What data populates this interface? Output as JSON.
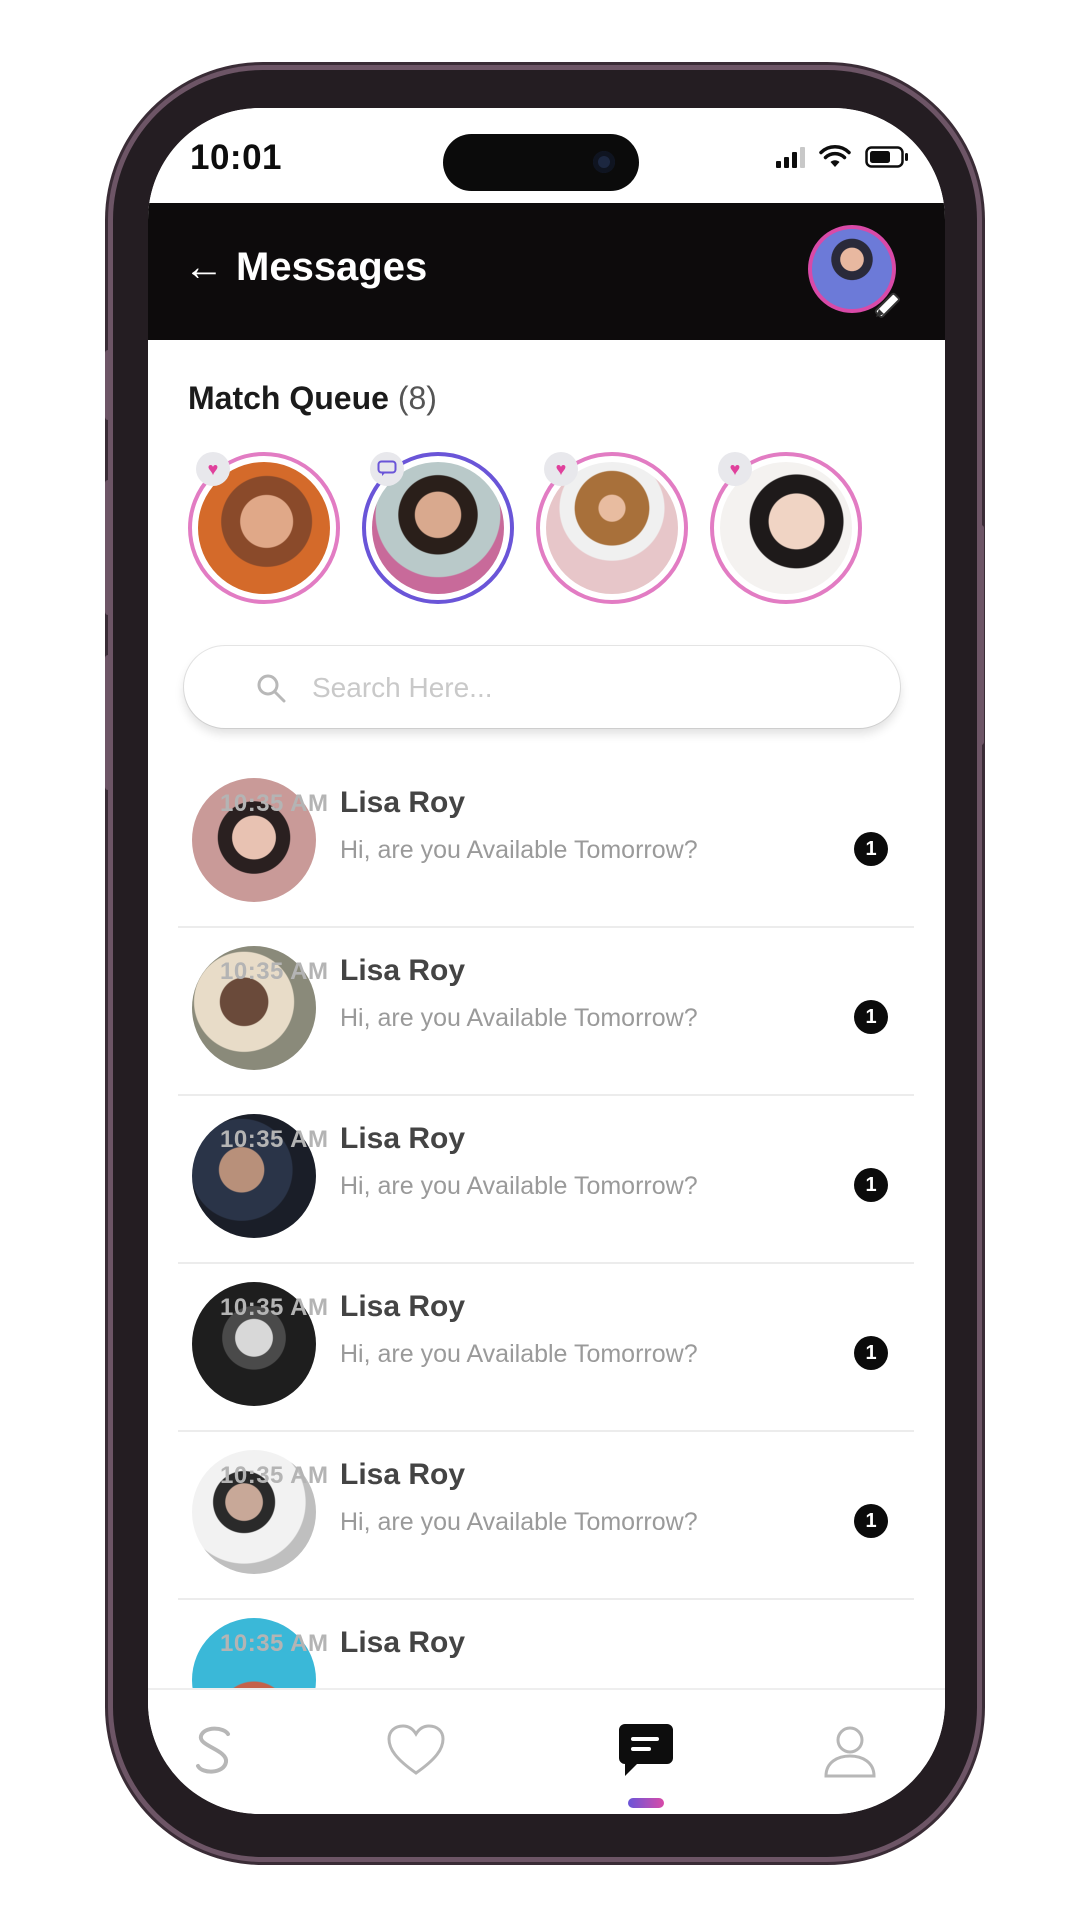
{
  "status_bar": {
    "time": "10:01"
  },
  "header": {
    "title": "Messages"
  },
  "match_queue": {
    "label": "Match Queue",
    "count": "(8)",
    "items": [
      {
        "badge": "heart-icon"
      },
      {
        "badge": "chat-icon"
      },
      {
        "badge": "heart-icon"
      },
      {
        "badge": "heart-icon"
      }
    ]
  },
  "search": {
    "placeholder": "Search Here..."
  },
  "conversations": [
    {
      "name": "Lisa Roy",
      "message": "Hi, are you Available Tomorrow?",
      "time": "10:35 AM",
      "unread": "1"
    },
    {
      "name": "Lisa Roy",
      "message": "Hi, are you Available Tomorrow?",
      "time": "10:35 AM",
      "unread": "1"
    },
    {
      "name": "Lisa Roy",
      "message": "Hi, are you Available Tomorrow?",
      "time": "10:35 AM",
      "unread": "1"
    },
    {
      "name": "Lisa Roy",
      "message": "Hi, are you Available Tomorrow?",
      "time": "10:35 AM",
      "unread": "1"
    },
    {
      "name": "Lisa Roy",
      "message": "Hi, are you Available Tomorrow?",
      "time": "10:35 AM",
      "unread": "1"
    },
    {
      "name": "Lisa Roy",
      "message": "",
      "time": "10:35 AM",
      "unread": ""
    }
  ],
  "bottom_nav": [
    {
      "icon": "swipe-s-icon",
      "active": false
    },
    {
      "icon": "heart-icon",
      "active": false
    },
    {
      "icon": "chat-icon",
      "active": true
    },
    {
      "icon": "profile-icon",
      "active": false
    }
  ],
  "colors": {
    "accent_pink": "#e27cc3",
    "accent_purple": "#6a55d8",
    "header_bg": "#0d0b0c"
  }
}
